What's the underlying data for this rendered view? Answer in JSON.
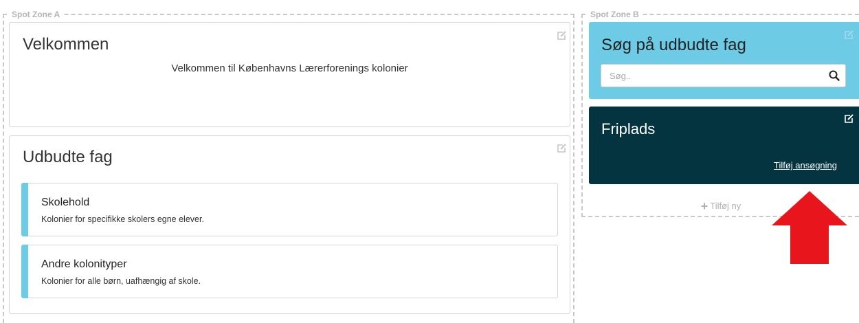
{
  "zone_a": {
    "label": "Spot Zone A",
    "welcome": {
      "title": "Velkommen",
      "text": "Velkommen til Københavns Lærerforenings kolonier"
    },
    "subjects": {
      "title": "Udbudte fag",
      "items": [
        {
          "title": "Skolehold",
          "description": "Kolonier for specifikke skolers egne elever."
        },
        {
          "title": "Andre kolonityper",
          "description": "Kolonier for alle børn, uafhængig af skole."
        }
      ]
    }
  },
  "zone_b": {
    "label": "Spot Zone B",
    "search_panel": {
      "title": "Søg på udbudte fag",
      "placeholder": "Søg..",
      "icon": "search-icon",
      "background": "#6ecbe5"
    },
    "friplads": {
      "title": "Friplads",
      "link": "Tilføj ansøgning",
      "background": "#033440"
    },
    "add_new": "Tilføj ny"
  },
  "colors": {
    "accent_bar": "#6ecbe5",
    "dashed_border": "#c8c8c8",
    "arrow": "#e8161c"
  },
  "icons": [
    "edit-icon",
    "search-icon",
    "plus-icon",
    "arrow-up-icon"
  ]
}
